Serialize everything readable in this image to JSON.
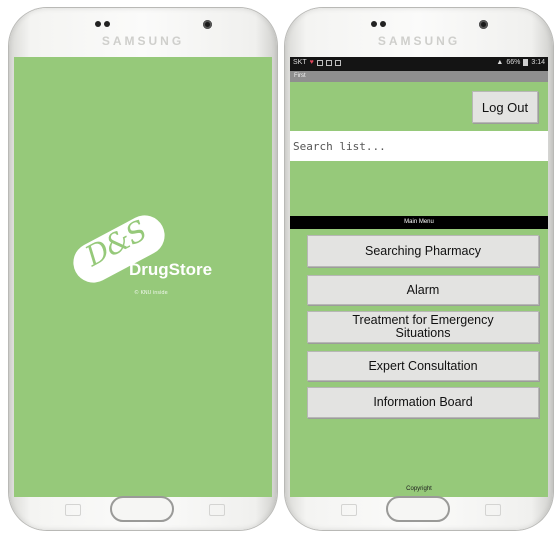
{
  "left_phone": {
    "brand": "SAMSUNG",
    "splash": {
      "logo_mark": "D&S",
      "app_name": "DrugStore",
      "copyright": "© KNU inside"
    }
  },
  "right_phone": {
    "brand": "SAMSUNG",
    "status_bar": {
      "carrier": "SKT",
      "right_text": "66%",
      "time": "3:14"
    },
    "title_bar": "First",
    "logout_label": "Log Out",
    "search": {
      "placeholder": "Search list..."
    },
    "menu_header": "Main Menu",
    "menu_items": [
      {
        "label": "Searching Pharmacy"
      },
      {
        "label": "Alarm"
      },
      {
        "label": "Treatment for Emergency Situations"
      },
      {
        "label": "Expert Consultation"
      },
      {
        "label": "Information Board"
      }
    ],
    "footer": "Copyright"
  },
  "colors": {
    "screen_bg": "#96c97a",
    "button_bg": "#e3e3e1",
    "status_bar": "#141414",
    "title_bar": "#8f8f8f"
  },
  "icons": [
    "heart-icon",
    "signal-icon",
    "battery-icon"
  ]
}
